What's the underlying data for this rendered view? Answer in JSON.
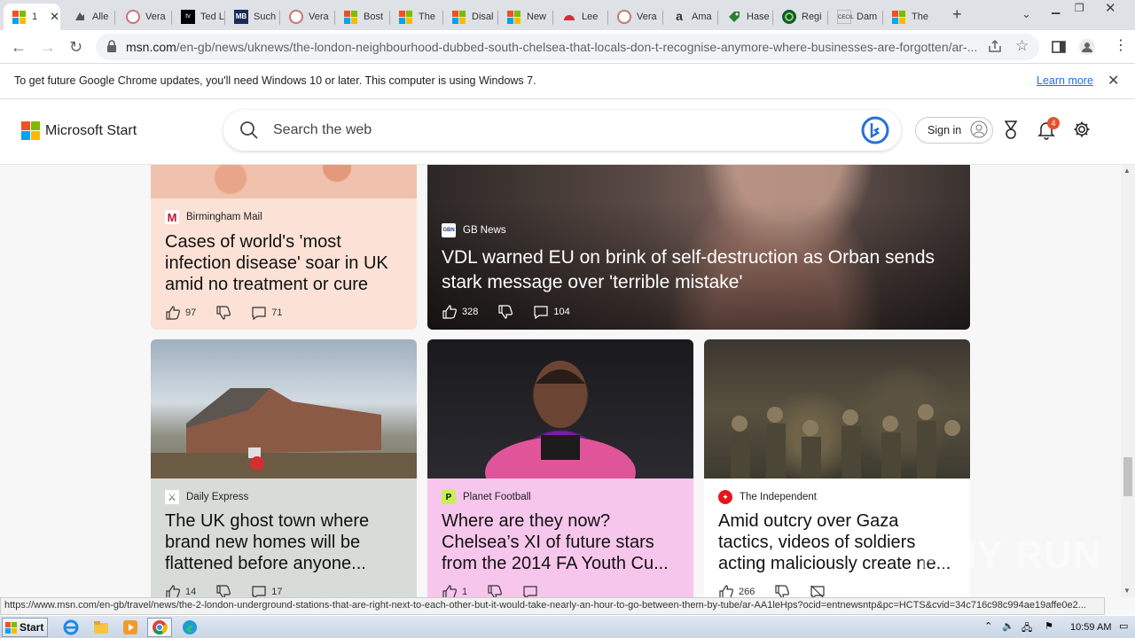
{
  "tabs": [
    {
      "label": "1",
      "icon": "microsoft-icon",
      "active": true
    },
    {
      "label": "Alle",
      "icon": "ublock-icon"
    },
    {
      "label": "Vera",
      "icon": "verasafe-icon"
    },
    {
      "label": "Ted L",
      "icon": "appletv-icon"
    },
    {
      "label": "Such",
      "icon": "mb-icon"
    },
    {
      "label": "Vera",
      "icon": "verasafe-icon"
    },
    {
      "label": "Bost",
      "icon": "microsoft-icon"
    },
    {
      "label": "The",
      "icon": "microsoft-icon"
    },
    {
      "label": "Disal",
      "icon": "microsoft-icon"
    },
    {
      "label": "New",
      "icon": "microsoft-icon"
    },
    {
      "label": "Lee",
      "icon": "red-arc-icon"
    },
    {
      "label": "Vera",
      "icon": "verasafe-icon"
    },
    {
      "label": "Ama",
      "icon": "amazon-icon"
    },
    {
      "label": "Hase",
      "icon": "tag-icon"
    },
    {
      "label": "Regi",
      "icon": "green-circle-icon"
    },
    {
      "label": "Dam",
      "icon": "cecil-icon"
    },
    {
      "label": "The",
      "icon": "microsoft-icon"
    }
  ],
  "omnibox": {
    "domain": "msn.com",
    "path": "/en-gb/news/uknews/the-london-neighbourhood-dubbed-south-chelsea-that-locals-don-t-recognise-anymore-where-businesses-are-forgotten/ar-..."
  },
  "infobar": {
    "message": "To get future Google Chrome updates, you'll need Windows 10 or later. This computer is using Windows 7.",
    "link": "Learn more"
  },
  "msn": {
    "brand": "Microsoft Start",
    "search_placeholder": "Search the web",
    "signin": "Sign in",
    "notification_count": "4"
  },
  "cards": [
    {
      "source": "Birmingham Mail",
      "title": "Cases of world's 'most infection disease' soar in UK amid no treatment or cure",
      "likes": "97",
      "comments": "71"
    },
    {
      "source": "GB News",
      "title": "VDL warned EU on brink of self-destruction as Orban sends stark message over 'terrible mistake'",
      "likes": "328",
      "comments": "104"
    },
    {
      "source": "Daily Express",
      "title": "The UK ghost town where brand new homes will be flattened before anyone...",
      "likes": "14",
      "comments": "17"
    },
    {
      "source": "Planet Football",
      "title": "Where are they now? Chelsea’s XI of future stars from the 2014 FA Youth Cu...",
      "likes": "1",
      "comments": ""
    },
    {
      "source": "The Independent",
      "title": "Amid outcry over Gaza tactics, videos of soldiers acting maliciously create ne...",
      "likes": "266",
      "comments": ""
    }
  ],
  "status_url": "https://www.msn.com/en-gb/travel/news/the-2-london-underground-stations-that-are-right-next-to-each-other-but-it-would-take-nearly-an-hour-to-go-between-them-by-tube/ar-AA1leHps?ocid=entnewsntp&pc=HCTS&cvid=34c716c98c994ae19affe0e2...",
  "taskbar": {
    "start": "Start",
    "clock": "10:59 AM"
  },
  "watermark": "ANY RUN",
  "colors": {
    "ms_red": "#f25022",
    "ms_green": "#7fba00",
    "ms_blue": "#00a4ef",
    "ms_yellow": "#ffb900",
    "link_blue": "#1a73e8"
  }
}
